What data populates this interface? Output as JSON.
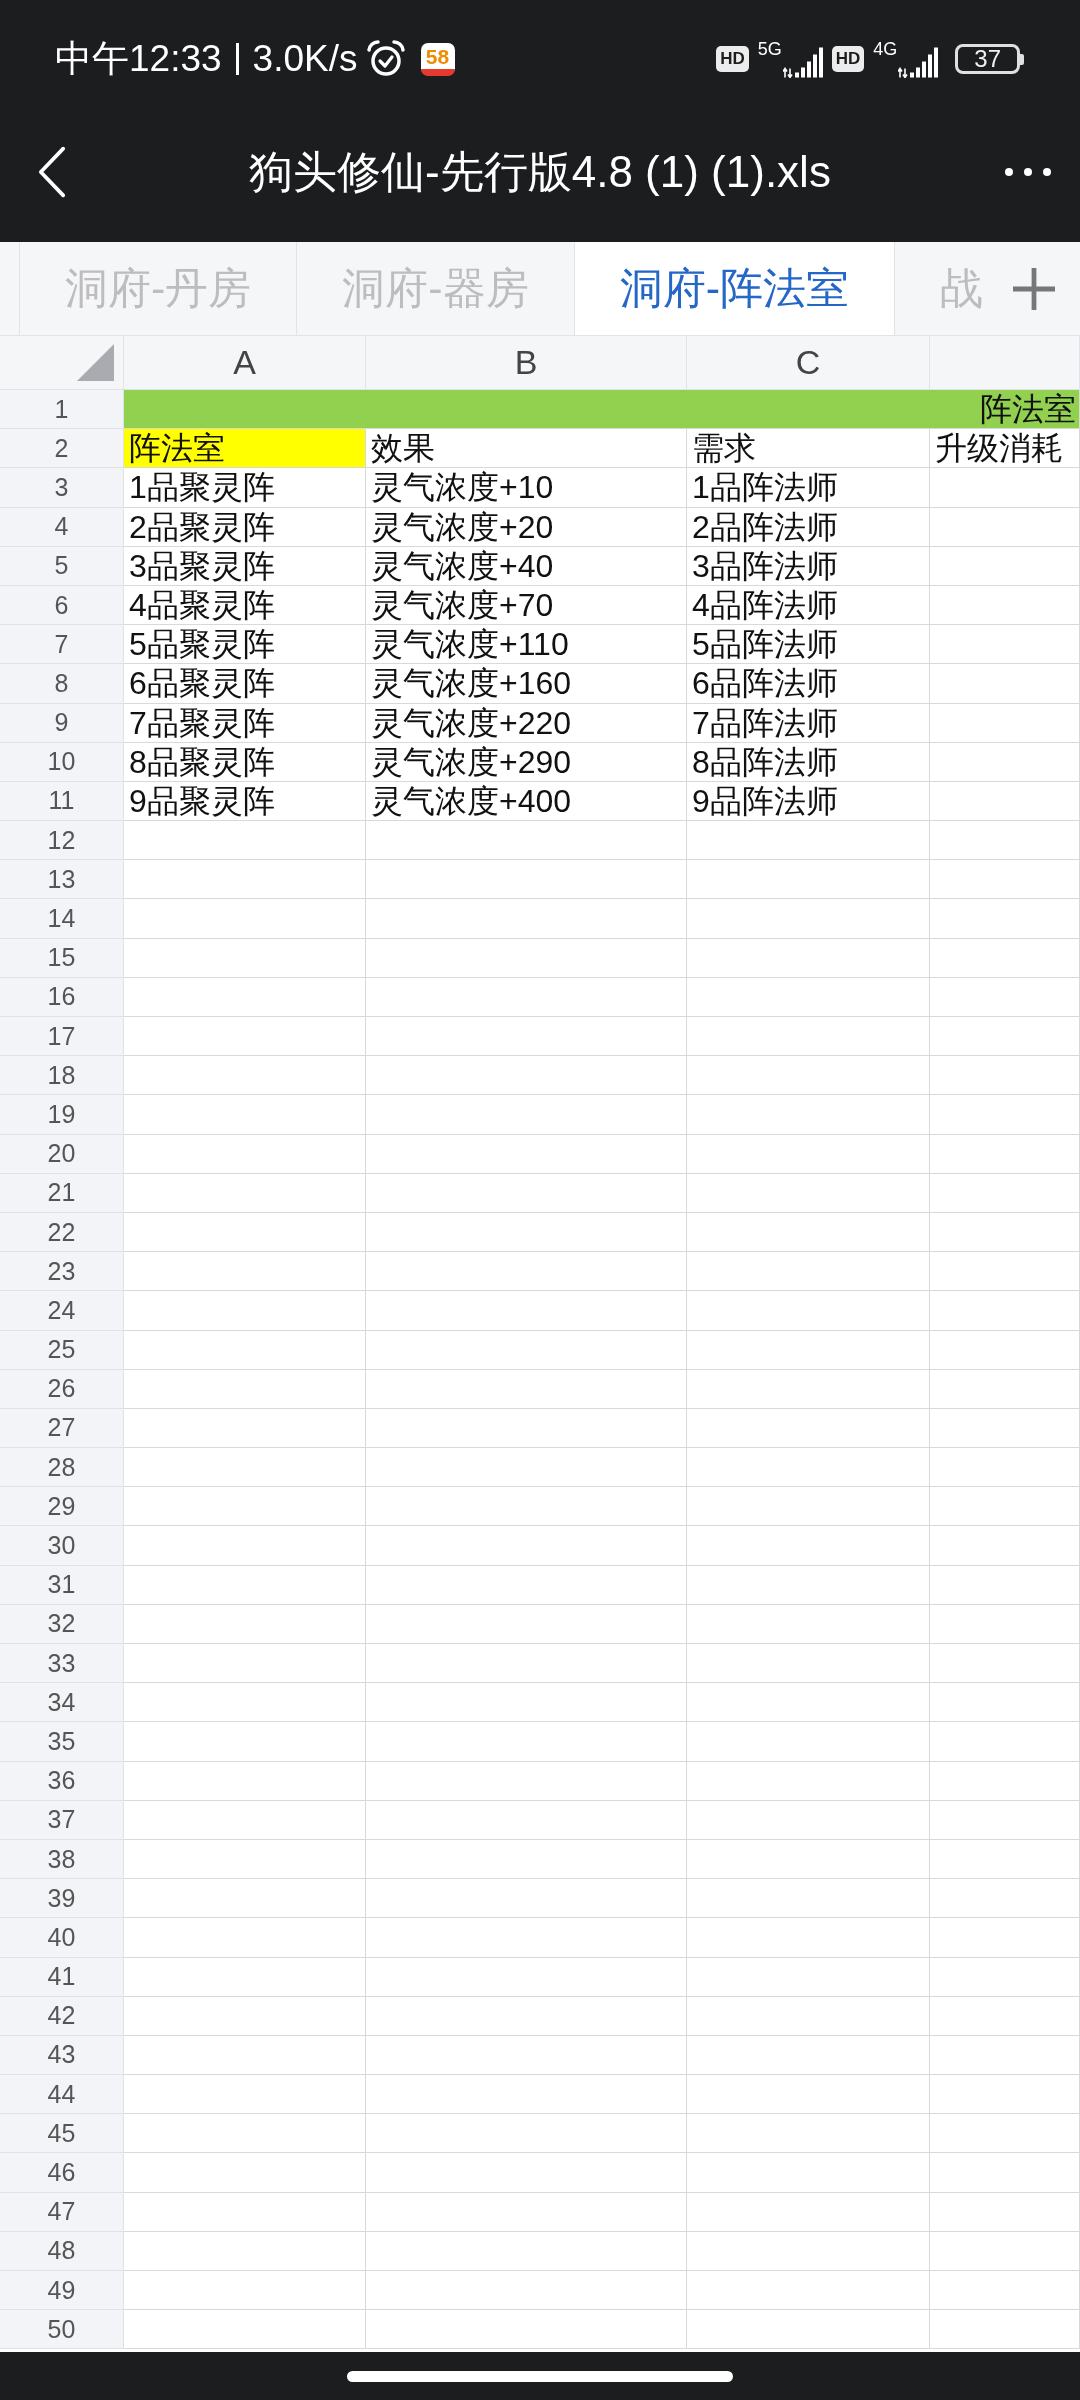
{
  "status_bar": {
    "time": "中午12:33",
    "speed": "3.0K/s",
    "app_badge": "58",
    "sims": [
      {
        "hd": "HD",
        "network": "5G"
      },
      {
        "hd": "HD",
        "network": "4G"
      }
    ],
    "battery": "37"
  },
  "title_bar": {
    "title": "狗头修仙-先行版4.8 (1) (1).xls"
  },
  "sheet_tabs": [
    {
      "label": "洞府-丹房",
      "selected": false
    },
    {
      "label": "洞府-器房",
      "selected": false
    },
    {
      "label": "洞府-阵法室",
      "selected": true
    },
    {
      "label": "战",
      "selected": false
    }
  ],
  "sheet": {
    "columns": [
      "A",
      "B",
      "C"
    ],
    "rows": [
      {
        "number": "1",
        "kind": "merged",
        "color": "#92d050",
        "text": "阵法室"
      },
      {
        "number": "2",
        "kind": "cells",
        "cells": [
          {
            "text": "阵法室",
            "color": "#ffff00"
          },
          {
            "text": "效果"
          },
          {
            "text": "需求"
          },
          {
            "text": "升级消耗"
          }
        ]
      },
      {
        "number": "3",
        "kind": "cells",
        "cells": [
          {
            "text": "1品聚灵阵"
          },
          {
            "text": "灵气浓度+10"
          },
          {
            "text": "1品阵法师"
          }
        ]
      },
      {
        "number": "4",
        "kind": "cells",
        "cells": [
          {
            "text": "2品聚灵阵"
          },
          {
            "text": "灵气浓度+20"
          },
          {
            "text": "2品阵法师"
          }
        ]
      },
      {
        "number": "5",
        "kind": "cells",
        "cells": [
          {
            "text": "3品聚灵阵"
          },
          {
            "text": "灵气浓度+40"
          },
          {
            "text": "3品阵法师"
          }
        ]
      },
      {
        "number": "6",
        "kind": "cells",
        "cells": [
          {
            "text": "4品聚灵阵"
          },
          {
            "text": "灵气浓度+70"
          },
          {
            "text": "4品阵法师"
          }
        ]
      },
      {
        "number": "7",
        "kind": "cells",
        "cells": [
          {
            "text": "5品聚灵阵"
          },
          {
            "text": "灵气浓度+110"
          },
          {
            "text": "5品阵法师"
          }
        ]
      },
      {
        "number": "8",
        "kind": "cells",
        "cells": [
          {
            "text": "6品聚灵阵"
          },
          {
            "text": "灵气浓度+160"
          },
          {
            "text": "6品阵法师"
          }
        ]
      },
      {
        "number": "9",
        "kind": "cells",
        "cells": [
          {
            "text": "7品聚灵阵"
          },
          {
            "text": "灵气浓度+220"
          },
          {
            "text": "7品阵法师"
          }
        ]
      },
      {
        "number": "10",
        "kind": "cells",
        "cells": [
          {
            "text": "8品聚灵阵"
          },
          {
            "text": "灵气浓度+290"
          },
          {
            "text": "8品阵法师"
          }
        ]
      },
      {
        "number": "11",
        "kind": "cells",
        "cells": [
          {
            "text": "9品聚灵阵"
          },
          {
            "text": "灵气浓度+400"
          },
          {
            "text": "9品阵法师"
          }
        ]
      },
      {
        "number": "12",
        "kind": "cells"
      },
      {
        "number": "13",
        "kind": "cells"
      },
      {
        "number": "14",
        "kind": "cells"
      },
      {
        "number": "15",
        "kind": "cells"
      },
      {
        "number": "16",
        "kind": "cells"
      },
      {
        "number": "17",
        "kind": "cells"
      },
      {
        "number": "18",
        "kind": "cells"
      },
      {
        "number": "19",
        "kind": "cells"
      },
      {
        "number": "20",
        "kind": "cells"
      },
      {
        "number": "21",
        "kind": "cells"
      },
      {
        "number": "22",
        "kind": "cells"
      },
      {
        "number": "23",
        "kind": "cells"
      },
      {
        "number": "24",
        "kind": "cells"
      },
      {
        "number": "25",
        "kind": "cells"
      },
      {
        "number": "26",
        "kind": "cells"
      },
      {
        "number": "27",
        "kind": "cells"
      },
      {
        "number": "28",
        "kind": "cells"
      },
      {
        "number": "29",
        "kind": "cells"
      },
      {
        "number": "30",
        "kind": "cells"
      },
      {
        "number": "31",
        "kind": "cells"
      },
      {
        "number": "32",
        "kind": "cells"
      },
      {
        "number": "33",
        "kind": "cells"
      },
      {
        "number": "34",
        "kind": "cells"
      },
      {
        "number": "35",
        "kind": "cells"
      },
      {
        "number": "36",
        "kind": "cells"
      },
      {
        "number": "37",
        "kind": "cells"
      },
      {
        "number": "38",
        "kind": "cells"
      },
      {
        "number": "39",
        "kind": "cells"
      },
      {
        "number": "40",
        "kind": "cells"
      },
      {
        "number": "41",
        "kind": "cells"
      },
      {
        "number": "42",
        "kind": "cells"
      },
      {
        "number": "43",
        "kind": "cells"
      },
      {
        "number": "44",
        "kind": "cells"
      },
      {
        "number": "45",
        "kind": "cells"
      },
      {
        "number": "46",
        "kind": "cells"
      },
      {
        "number": "47",
        "kind": "cells"
      },
      {
        "number": "48",
        "kind": "cells"
      },
      {
        "number": "49",
        "kind": "cells"
      },
      {
        "number": "50",
        "kind": "cells"
      }
    ]
  }
}
